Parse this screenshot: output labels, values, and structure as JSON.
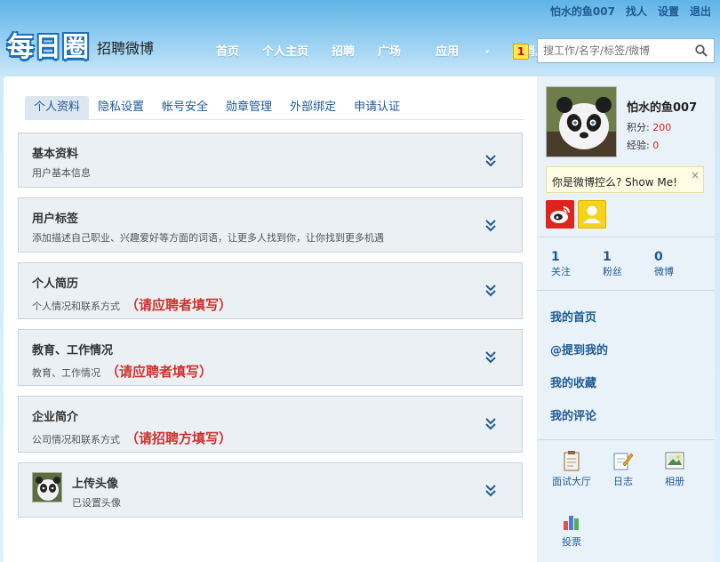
{
  "topbar": {
    "username": "怕水的鱼007",
    "find_people": "找人",
    "settings": "设置",
    "logout": "退出"
  },
  "logo": {
    "mark": "每日圈",
    "subtitle": "招聘微博"
  },
  "nav": {
    "items": [
      "首页",
      "个人主页",
      "招聘",
      "广场"
    ],
    "apps": "应用",
    "apps_arrow": "▾",
    "messages": "消息",
    "message_count": "1"
  },
  "search": {
    "placeholder": "搜工作/名字/标签/微博"
  },
  "tabs": [
    "个人资料",
    "隐私设置",
    "帐号安全",
    "勋章管理",
    "外部绑定",
    "申请认证"
  ],
  "panels": [
    {
      "title": "基本资料",
      "desc": "用户基本信息",
      "note": ""
    },
    {
      "title": "用户标签",
      "desc": "添加描述自己职业、兴趣爱好等方面的词语，让更多人找到你，让你找到更多机遇",
      "note": ""
    },
    {
      "title": "个人简历",
      "desc": "个人情况和联系方式",
      "note": "（请应聘者填写）"
    },
    {
      "title": "教育、工作情况",
      "desc": "教育、工作情况",
      "note": "（请应聘者填写）"
    },
    {
      "title": "企业简介",
      "desc": "公司情况和联系方式",
      "note": "（请招聘方填写）"
    },
    {
      "title": "上传头像",
      "desc": "已设置头像",
      "note": ""
    }
  ],
  "profile": {
    "name": "怕水的鱼007",
    "points_label": "积分:",
    "points": "200",
    "exp_label": "经验:",
    "exp": "0"
  },
  "tip": {
    "text": "你是微博控么? Show Me!",
    "close": "×"
  },
  "counts": [
    {
      "num": "1",
      "label": "关注"
    },
    {
      "num": "1",
      "label": "粉丝"
    },
    {
      "num": "0",
      "label": "微博"
    }
  ],
  "links": [
    "我的首页",
    "@提到我的",
    "我的收藏",
    "我的评论"
  ],
  "apps": [
    "面试大厅",
    "日志",
    "相册",
    "投票"
  ],
  "colors": {
    "link": "#1e5a94",
    "highlight": "#d0312d",
    "weibo_red": "#e0231c",
    "badge_yellow": "#ffe94d"
  }
}
